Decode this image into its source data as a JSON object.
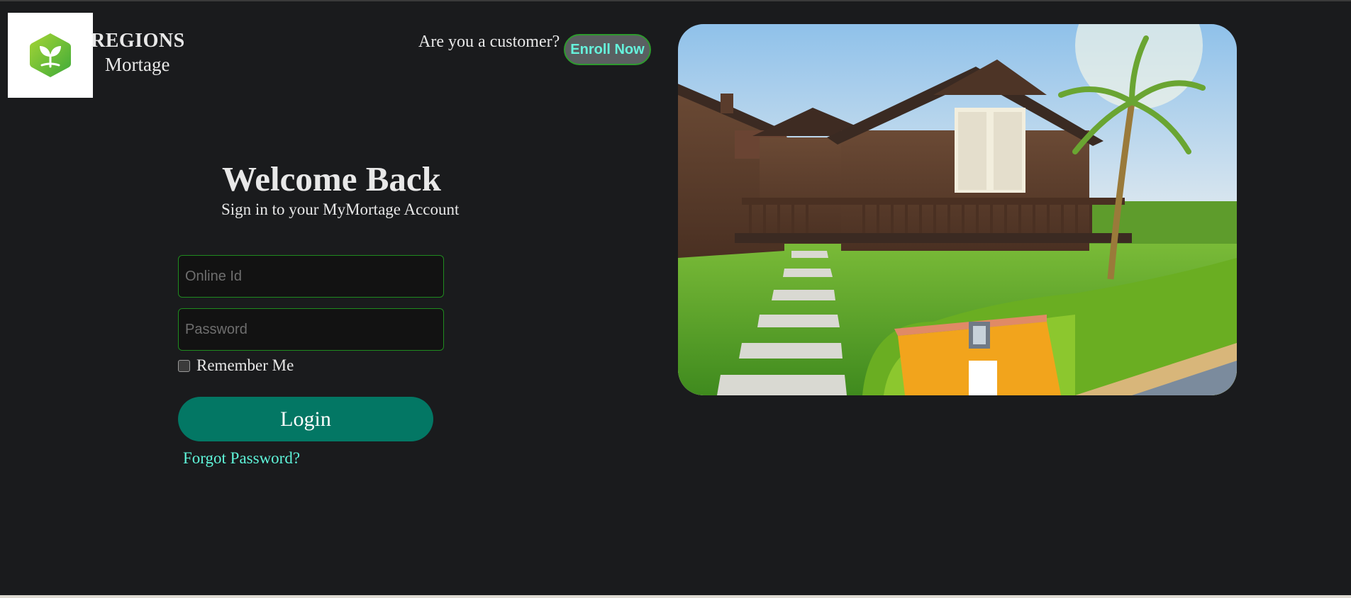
{
  "header": {
    "brand_title": "REGIONS",
    "brand_subtitle": "Mortage",
    "customer_prompt": "Are you a customer?",
    "enroll_label": "Enroll Now"
  },
  "login": {
    "heading": "Welcome Back",
    "subheading": "Sign in to your MyMortage Account",
    "online_id_placeholder": "Online Id",
    "online_id_value": "",
    "password_placeholder": "Password",
    "password_value": "",
    "remember_label": "Remember Me",
    "remember_checked": false,
    "login_label": "Login",
    "forgot_label": "Forgot Password?"
  },
  "icons": {
    "logo": "leaf-hexagon-logo-icon",
    "checkbox": "checkbox-unchecked-icon"
  },
  "colors": {
    "background": "#1a1b1d",
    "accent_teal": "#037764",
    "link_cyan": "#5ff5da",
    "input_border": "#1f8a1f",
    "logo_green": "#6cbf2e"
  }
}
